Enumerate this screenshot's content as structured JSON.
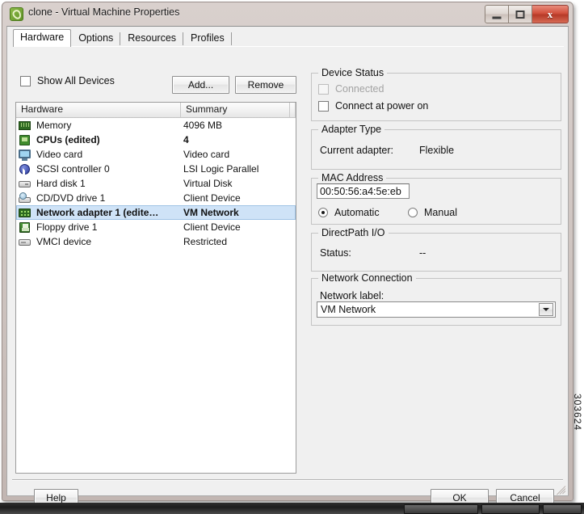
{
  "window": {
    "title": "clone - Virtual Machine Properties",
    "icon": "vm-clone-icon",
    "controls": {
      "minimize": "minimize-button",
      "maximize": "maximize-button",
      "close_glyph": "x"
    }
  },
  "tabs": [
    {
      "label": "Hardware",
      "active": true
    },
    {
      "label": "Options",
      "active": false
    },
    {
      "label": "Resources",
      "active": false
    },
    {
      "label": "Profiles",
      "active": false
    }
  ],
  "left_pane": {
    "show_all_devices": {
      "label": "Show All Devices",
      "checked": false
    },
    "add_button": "Add...",
    "remove_button": "Remove",
    "columns": [
      "Hardware",
      "Summary"
    ],
    "rows": [
      {
        "icon": "memory-icon",
        "name": "Memory",
        "summary": "4096 MB",
        "bold": false,
        "selected": false
      },
      {
        "icon": "cpu-icon",
        "name": "CPUs (edited)",
        "summary": "4",
        "bold": true,
        "selected": false
      },
      {
        "icon": "video-card-icon",
        "name": "Video card",
        "summary": "Video card",
        "bold": false,
        "selected": false
      },
      {
        "icon": "scsi-controller-icon",
        "name": "SCSI controller 0",
        "summary": "LSI Logic Parallel",
        "bold": false,
        "selected": false
      },
      {
        "icon": "hard-disk-icon",
        "name": "Hard disk 1",
        "summary": "Virtual Disk",
        "bold": false,
        "selected": false
      },
      {
        "icon": "cd-dvd-drive-icon",
        "name": "CD/DVD drive 1",
        "summary": "Client Device",
        "bold": false,
        "selected": false
      },
      {
        "icon": "network-adapter-icon",
        "name": "Network adapter 1 (edite…",
        "summary": "VM Network",
        "bold": true,
        "selected": true
      },
      {
        "icon": "floppy-drive-icon",
        "name": "Floppy drive 1",
        "summary": "Client Device",
        "bold": false,
        "selected": false
      },
      {
        "icon": "vmci-device-icon",
        "name": "VMCI device",
        "summary": "Restricted",
        "bold": false,
        "selected": false
      }
    ]
  },
  "right_pane": {
    "device_status": {
      "legend": "Device Status",
      "connected": {
        "label": "Connected",
        "checked": false,
        "disabled": true
      },
      "connect_at_power_on": {
        "label": "Connect at power on",
        "checked": false,
        "disabled": false
      }
    },
    "adapter_type": {
      "legend": "Adapter Type",
      "current_adapter_label": "Current adapter:",
      "current_adapter_value": "Flexible"
    },
    "mac_address": {
      "legend": "MAC Address",
      "value": "00:50:56:a4:5e:eb",
      "automatic_label": "Automatic",
      "manual_label": "Manual",
      "mode": "Automatic"
    },
    "directpath_io": {
      "legend": "DirectPath I/O",
      "status_label": "Status:",
      "status_value": "--"
    },
    "network_connection": {
      "legend": "Network Connection",
      "network_label_caption": "Network label:",
      "network_label_value": "VM Network"
    }
  },
  "footer": {
    "help": "Help",
    "ok": "OK",
    "cancel": "Cancel"
  },
  "watermark": "303624",
  "colors": {
    "dialog_face": "#f0f0f0",
    "selection": "#cfe3f7",
    "frame": "#cfc5c1",
    "close_button": "#d1503c"
  }
}
